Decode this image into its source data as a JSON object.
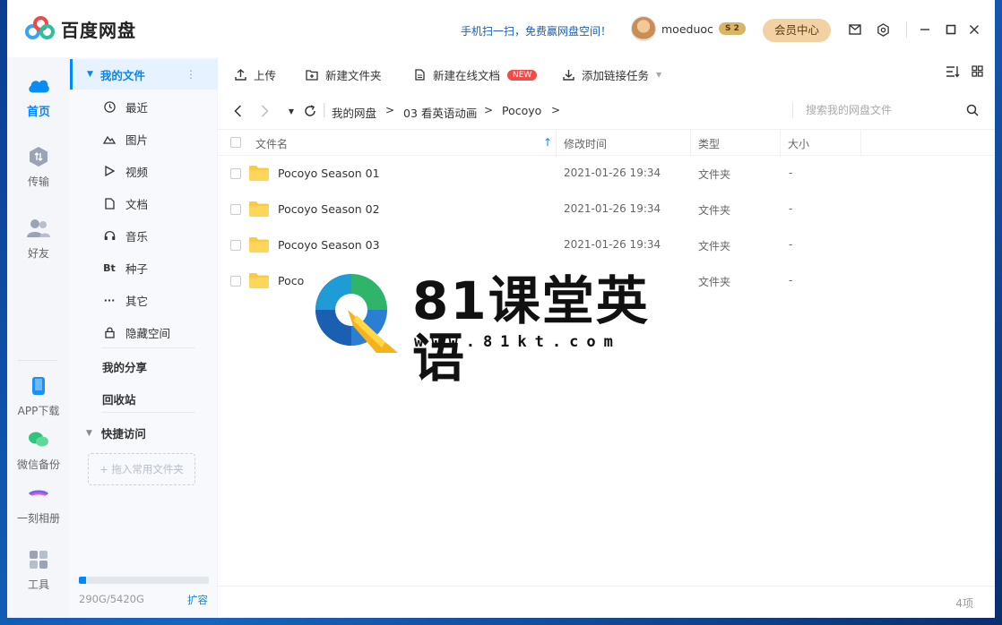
{
  "app": {
    "name": "百度网盘",
    "promo": "手机扫一扫，免费赢网盘空间！"
  },
  "user": {
    "name": "moeduoc",
    "vip_level": "2",
    "member_center": "会员中心"
  },
  "rail": [
    {
      "label": "首页",
      "icon": "cloud-icon"
    },
    {
      "label": "传输",
      "icon": "transfer-icon"
    },
    {
      "label": "好友",
      "icon": "friends-icon"
    },
    {
      "label": "APP下载",
      "icon": "phone-icon"
    },
    {
      "label": "微信备份",
      "icon": "wechat-icon"
    },
    {
      "label": "一刻相册",
      "icon": "album-icon"
    },
    {
      "label": "工具",
      "icon": "tools-icon"
    }
  ],
  "sidebar": {
    "my_files": "我的文件",
    "items": [
      {
        "label": "最近",
        "icon": "clock-icon"
      },
      {
        "label": "图片",
        "icon": "image-icon"
      },
      {
        "label": "视频",
        "icon": "video-icon"
      },
      {
        "label": "文档",
        "icon": "document-icon"
      },
      {
        "label": "音乐",
        "icon": "headphones-icon"
      },
      {
        "label": "种子",
        "icon": "bt-icon",
        "glyph": "Bt"
      },
      {
        "label": "其它",
        "icon": "more-icon",
        "glyph": "···"
      },
      {
        "label": "隐藏空间",
        "icon": "lock-icon"
      }
    ],
    "my_share": "我的分享",
    "recycle": "回收站",
    "quick_access": "快捷访问",
    "drop_hint": "+ 拖入常用文件夹",
    "quota_text": "290G/5420G",
    "quota_fraction": 0.0535,
    "expand": "扩容"
  },
  "toolbar": {
    "upload": "上传",
    "new_folder": "新建文件夹",
    "new_doc": "新建在线文档",
    "new_badge": "NEW",
    "add_link": "添加链接任务"
  },
  "breadcrumb": [
    "我的网盘",
    "03 看英语动画",
    "Pocoyo"
  ],
  "search": {
    "placeholder": "搜索我的网盘文件"
  },
  "table": {
    "headers": {
      "name": "文件名",
      "modified": "修改时间",
      "type": "类型",
      "size": "大小"
    },
    "rows": [
      {
        "name": "Pocoyo Season 01",
        "modified": "2021-01-26 19:34",
        "type": "文件夹",
        "size": "-"
      },
      {
        "name": "Pocoyo Season 02",
        "modified": "2021-01-26 19:34",
        "type": "文件夹",
        "size": "-"
      },
      {
        "name": "Pocoyo Season 03",
        "modified": "2021-01-26 19:34",
        "type": "文件夹",
        "size": "-"
      },
      {
        "name": "Poco",
        "modified": "",
        "type": "文件夹",
        "size": "-"
      }
    ]
  },
  "footer": {
    "count": "4项"
  },
  "watermark": {
    "title": "81课堂英语",
    "url": "www.81kt.com"
  },
  "colors": {
    "accent": "#0088ff",
    "folder": "#ffc83d",
    "badge": "#f04c4c"
  }
}
